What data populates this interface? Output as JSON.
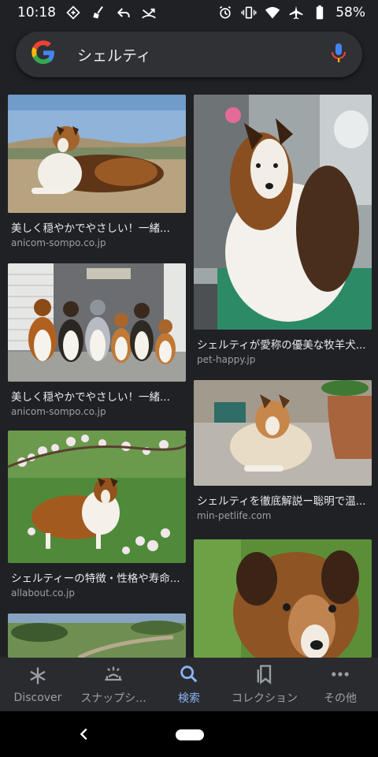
{
  "status_bar": {
    "time": "10:18",
    "battery": "58%"
  },
  "search": {
    "query": "シェルティ"
  },
  "results": {
    "left": [
      {
        "caption": "美しく穏やかでやさしい！一緒...",
        "source": "anicom-sompo.co.jp"
      },
      {
        "caption": "美しく穏やかでやさしい！一緒...",
        "source": "anicom-sompo.co.jp"
      },
      {
        "caption": "シェルティーの特徴・性格や寿命...",
        "source": "allabout.co.jp"
      }
    ],
    "right": [
      {
        "caption": "シェルティが愛称の優美な牧羊犬...",
        "source": "pet-happy.jp"
      },
      {
        "caption": "シェルティを徹底解説ー聡明で温...",
        "source": "min-petlife.com"
      }
    ]
  },
  "bottom_nav": {
    "discover": "Discover",
    "snapshot": "スナップシ...",
    "search": "検索",
    "collections": "コレクション",
    "more": "その他"
  },
  "colors": {
    "background": "#202124",
    "accent": "#8ab4f8",
    "secondary_text": "#9aa0a6"
  }
}
